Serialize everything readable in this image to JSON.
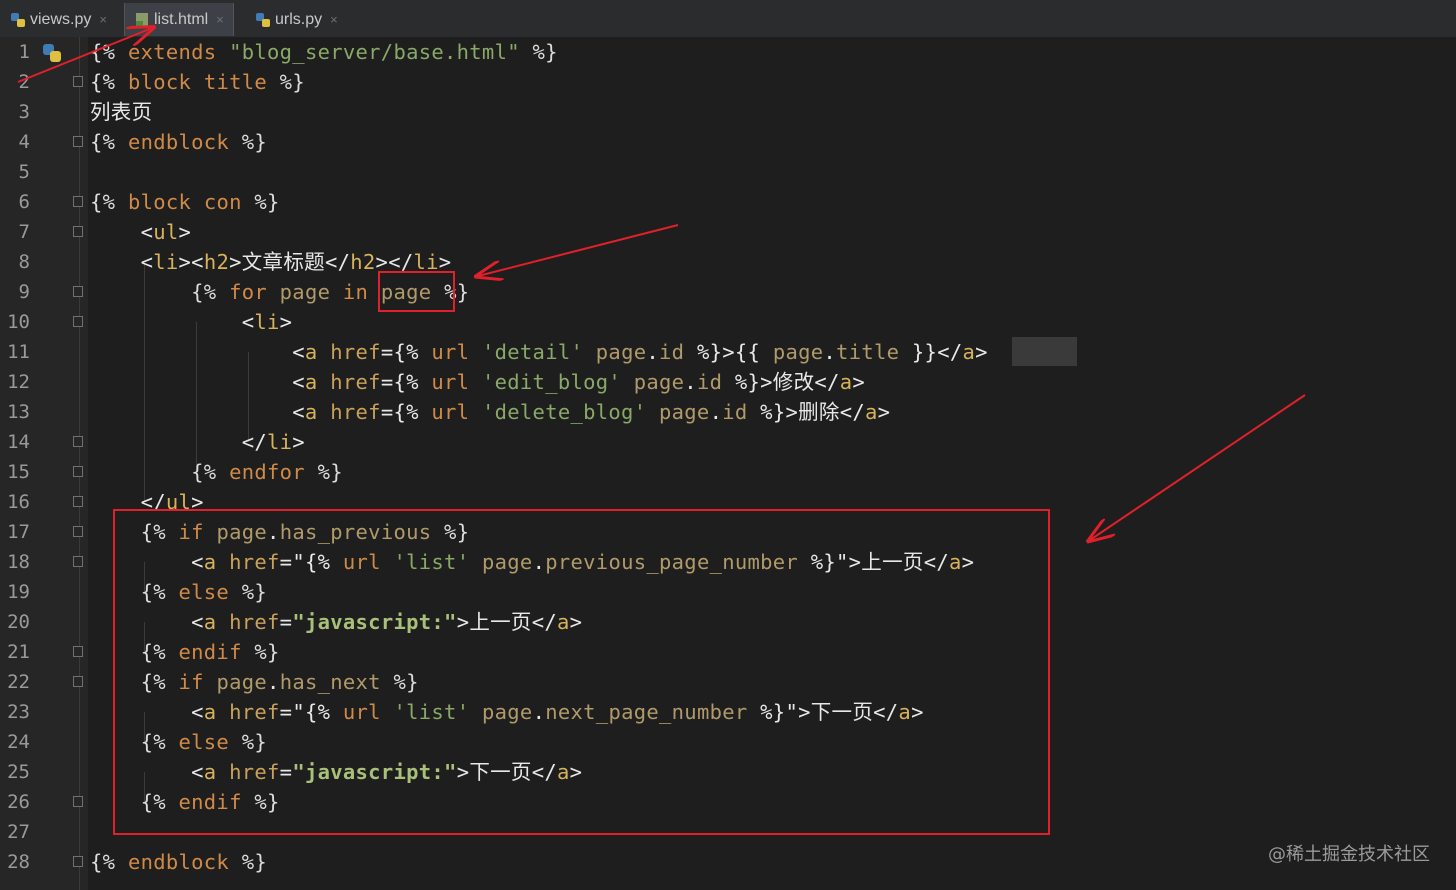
{
  "tabs": [
    {
      "label": "views.py",
      "icon": "python-file-icon",
      "active": false
    },
    {
      "label": "list.html",
      "icon": "html-file-icon",
      "active": true
    },
    {
      "label": "urls.py",
      "icon": "python-file-icon",
      "active": false
    }
  ],
  "close_glyph": "×",
  "watermark": "@稀土掘金技术社区",
  "colors": {
    "background": "#1e1e1e",
    "annotation": "#e0202a",
    "keyword": "#d08a48",
    "string": "#8aa868",
    "tag": "#d7b25a"
  },
  "lines": [
    {
      "n": "1",
      "tokens": [
        [
          "delim",
          "{% "
        ],
        [
          "kw",
          "extends"
        ],
        [
          "text",
          " "
        ],
        [
          "str",
          "\"blog_server/base.html\""
        ],
        [
          "delim",
          " %}"
        ]
      ]
    },
    {
      "n": "2",
      "tokens": [
        [
          "delim",
          "{% "
        ],
        [
          "kw",
          "block"
        ],
        [
          "text",
          " "
        ],
        [
          "kw",
          "title"
        ],
        [
          "delim",
          " %}"
        ]
      ]
    },
    {
      "n": "3",
      "tokens": [
        [
          "text",
          "列表页"
        ]
      ]
    },
    {
      "n": "4",
      "tokens": [
        [
          "delim",
          "{% "
        ],
        [
          "kw",
          "endblock"
        ],
        [
          "delim",
          " %}"
        ]
      ]
    },
    {
      "n": "5",
      "tokens": []
    },
    {
      "n": "6",
      "tokens": [
        [
          "delim",
          "{% "
        ],
        [
          "kw",
          "block"
        ],
        [
          "text",
          " "
        ],
        [
          "kw",
          "con"
        ],
        [
          "delim",
          " %}"
        ]
      ]
    },
    {
      "n": "7",
      "tokens": [
        [
          "text",
          "    <"
        ],
        [
          "tag",
          "ul"
        ],
        [
          "text",
          ">"
        ]
      ]
    },
    {
      "n": "8",
      "tokens": [
        [
          "text",
          "    <"
        ],
        [
          "tag",
          "li"
        ],
        [
          "text",
          "><"
        ],
        [
          "tag",
          "h2"
        ],
        [
          "text",
          ">文章标题</"
        ],
        [
          "tag",
          "h2"
        ],
        [
          "text",
          "></"
        ],
        [
          "tag",
          "li"
        ],
        [
          "text",
          ">"
        ]
      ]
    },
    {
      "n": "9",
      "tokens": [
        [
          "delim",
          "        {% "
        ],
        [
          "kw",
          "for"
        ],
        [
          "text",
          " "
        ],
        [
          "var",
          "page"
        ],
        [
          "text",
          " "
        ],
        [
          "kw",
          "in"
        ],
        [
          "text",
          " "
        ],
        [
          "var",
          "page"
        ],
        [
          "delim",
          " %}"
        ]
      ]
    },
    {
      "n": "10",
      "tokens": [
        [
          "text",
          "            <"
        ],
        [
          "tag",
          "li"
        ],
        [
          "text",
          ">"
        ]
      ]
    },
    {
      "n": "11",
      "tokens": [
        [
          "text",
          "                <"
        ],
        [
          "tag",
          "a"
        ],
        [
          "text",
          " "
        ],
        [
          "attr",
          "href"
        ],
        [
          "text",
          "={% "
        ],
        [
          "kw",
          "url"
        ],
        [
          "text",
          " "
        ],
        [
          "str",
          "'detail'"
        ],
        [
          "text",
          " "
        ],
        [
          "var",
          "page"
        ],
        [
          "text",
          "."
        ],
        [
          "var",
          "id"
        ],
        [
          "text",
          " %}>{{ "
        ],
        [
          "var",
          "page"
        ],
        [
          "text",
          "."
        ],
        [
          "var",
          "title"
        ],
        [
          "text",
          " }}</"
        ],
        [
          "tag",
          "a"
        ],
        [
          "text",
          ">"
        ]
      ]
    },
    {
      "n": "12",
      "tokens": [
        [
          "text",
          "                <"
        ],
        [
          "tag",
          "a"
        ],
        [
          "text",
          " "
        ],
        [
          "attr",
          "href"
        ],
        [
          "text",
          "={% "
        ],
        [
          "kw",
          "url"
        ],
        [
          "text",
          " "
        ],
        [
          "str",
          "'edit_blog'"
        ],
        [
          "text",
          " "
        ],
        [
          "var",
          "page"
        ],
        [
          "text",
          "."
        ],
        [
          "var",
          "id"
        ],
        [
          "text",
          " %}>修改</"
        ],
        [
          "tag",
          "a"
        ],
        [
          "text",
          ">"
        ]
      ]
    },
    {
      "n": "13",
      "tokens": [
        [
          "text",
          "                <"
        ],
        [
          "tag",
          "a"
        ],
        [
          "text",
          " "
        ],
        [
          "attr",
          "href"
        ],
        [
          "text",
          "={% "
        ],
        [
          "kw",
          "url"
        ],
        [
          "text",
          " "
        ],
        [
          "str",
          "'delete_blog'"
        ],
        [
          "text",
          " "
        ],
        [
          "var",
          "page"
        ],
        [
          "text",
          "."
        ],
        [
          "var",
          "id"
        ],
        [
          "text",
          " %}>删除</"
        ],
        [
          "tag",
          "a"
        ],
        [
          "text",
          ">"
        ]
      ]
    },
    {
      "n": "14",
      "tokens": [
        [
          "text",
          "            </"
        ],
        [
          "tag",
          "li"
        ],
        [
          "text",
          ">"
        ]
      ]
    },
    {
      "n": "15",
      "tokens": [
        [
          "delim",
          "        {% "
        ],
        [
          "kw",
          "endfor"
        ],
        [
          "delim",
          " %}"
        ]
      ]
    },
    {
      "n": "16",
      "tokens": [
        [
          "text",
          "    </"
        ],
        [
          "tag",
          "ul"
        ],
        [
          "text",
          ">"
        ]
      ]
    },
    {
      "n": "17",
      "tokens": [
        [
          "delim",
          "    {% "
        ],
        [
          "kw",
          "if"
        ],
        [
          "text",
          " "
        ],
        [
          "var",
          "page"
        ],
        [
          "text",
          "."
        ],
        [
          "var",
          "has_previous"
        ],
        [
          "delim",
          " %}"
        ]
      ]
    },
    {
      "n": "18",
      "tokens": [
        [
          "text",
          "        <"
        ],
        [
          "tag",
          "a"
        ],
        [
          "text",
          " "
        ],
        [
          "attr",
          "href"
        ],
        [
          "text",
          "=\"{% "
        ],
        [
          "kw",
          "url"
        ],
        [
          "text",
          " "
        ],
        [
          "str",
          "'list'"
        ],
        [
          "text",
          " "
        ],
        [
          "var",
          "page"
        ],
        [
          "text",
          "."
        ],
        [
          "var",
          "previous_page_number"
        ],
        [
          "text",
          " %}\">上一页</"
        ],
        [
          "tag",
          "a"
        ],
        [
          "text",
          ">"
        ]
      ]
    },
    {
      "n": "19",
      "tokens": [
        [
          "delim",
          "    {% "
        ],
        [
          "kw",
          "else"
        ],
        [
          "delim",
          " %}"
        ]
      ]
    },
    {
      "n": "20",
      "tokens": [
        [
          "text",
          "        <"
        ],
        [
          "tag",
          "a"
        ],
        [
          "text",
          " "
        ],
        [
          "attr",
          "href"
        ],
        [
          "text",
          "="
        ],
        [
          "bold",
          "\"javascript:\""
        ],
        [
          "text",
          ">上一页</"
        ],
        [
          "tag",
          "a"
        ],
        [
          "text",
          ">"
        ]
      ]
    },
    {
      "n": "21",
      "tokens": [
        [
          "delim",
          "    {% "
        ],
        [
          "kw",
          "endif"
        ],
        [
          "delim",
          " %}"
        ]
      ]
    },
    {
      "n": "22",
      "tokens": [
        [
          "delim",
          "    {% "
        ],
        [
          "kw",
          "if"
        ],
        [
          "text",
          " "
        ],
        [
          "var",
          "page"
        ],
        [
          "text",
          "."
        ],
        [
          "var",
          "has_next"
        ],
        [
          "delim",
          " %}"
        ]
      ]
    },
    {
      "n": "23",
      "tokens": [
        [
          "text",
          "        <"
        ],
        [
          "tag",
          "a"
        ],
        [
          "text",
          " "
        ],
        [
          "attr",
          "href"
        ],
        [
          "text",
          "=\"{% "
        ],
        [
          "kw",
          "url"
        ],
        [
          "text",
          " "
        ],
        [
          "str",
          "'list'"
        ],
        [
          "text",
          " "
        ],
        [
          "var",
          "page"
        ],
        [
          "text",
          "."
        ],
        [
          "var",
          "next_page_number"
        ],
        [
          "text",
          " %}\">下一页</"
        ],
        [
          "tag",
          "a"
        ],
        [
          "text",
          ">"
        ]
      ]
    },
    {
      "n": "24",
      "tokens": [
        [
          "delim",
          "    {% "
        ],
        [
          "kw",
          "else"
        ],
        [
          "delim",
          " %}"
        ]
      ]
    },
    {
      "n": "25",
      "tokens": [
        [
          "text",
          "        <"
        ],
        [
          "tag",
          "a"
        ],
        [
          "text",
          " "
        ],
        [
          "attr",
          "href"
        ],
        [
          "text",
          "="
        ],
        [
          "bold",
          "\"javascript:\""
        ],
        [
          "text",
          ">下一页</"
        ],
        [
          "tag",
          "a"
        ],
        [
          "text",
          ">"
        ]
      ]
    },
    {
      "n": "26",
      "tokens": [
        [
          "delim",
          "    {% "
        ],
        [
          "kw",
          "endif"
        ],
        [
          "delim",
          " %}"
        ]
      ]
    },
    {
      "n": "27",
      "tokens": []
    },
    {
      "n": "28",
      "tokens": [
        [
          "delim",
          "{% "
        ],
        [
          "kw",
          "endblock"
        ],
        [
          "delim",
          " %}"
        ]
      ]
    }
  ]
}
